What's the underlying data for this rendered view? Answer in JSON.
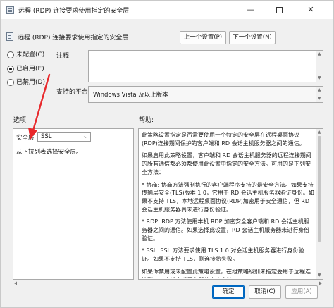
{
  "window": {
    "title": "远程 (RDP) 连接要求使用指定的安全层",
    "controls": {
      "minimize": "—",
      "close": "✕"
    }
  },
  "header": {
    "policy_name": "远程 (RDP) 连接要求使用指定的安全层",
    "prev_button": "上一个设置(P)",
    "next_button": "下一个设置(N)"
  },
  "state": {
    "options": [
      {
        "label": "未配置(C)",
        "selected": false
      },
      {
        "label": "已启用(E)",
        "selected": true
      },
      {
        "label": "已禁用(D)",
        "selected": false
      }
    ]
  },
  "comment": {
    "label": "注释:",
    "value": ""
  },
  "supported_on": {
    "label": "支持的平台:",
    "value": "Windows Vista 及以上版本"
  },
  "options_panel": {
    "label": "选项:",
    "field_label": "安全层",
    "selected_value": "SSL",
    "description": "从下拉列表选择安全层。"
  },
  "help_panel": {
    "label": "帮助:",
    "paragraphs": [
      "此策略设置指定是否需要使用一个特定的安全层在远程桌面协议(RDP)连接期间保护的客户端和 RD 会话主机服务器之间的通信。",
      "如果启用此策略设置，客户端和 RD 会话主机服务器的远程连接期间的所有通信都必须都使用此设置中指定的安全方法。可用的是下列安全方法：",
      "* 协商: 协商方法强制执行的客户端程序支持的最安全方法。如果支持传输层安全(TLS)版本 1.0，它用于 RD 会话主机服务器验证身份。如果不支持 TLS，本地远程桌面协议(RDP)加密用于安全通信，但 RD 会话主机服务器尚未进行身份验证。",
      "* RDP: RDP 方法使用本机 RDP 加密安全客户端和 RD 会话主机服务器之间的通信。如果选择此设置，RD 会话主机服务器未进行身份验证。",
      "* SSL: SSL 方法要求使用 TLS 1.0 对会话主机服务器进行身份验证。如果不支持 TLS，则连接将失败。",
      "如果你禁用或未配置此策略设置，在组策略级别未指定要用于远程连接到 RD 会话主机服务器的安全方法。"
    ]
  },
  "footer": {
    "ok": "确定",
    "cancel": "取消(C)",
    "apply": "应用(A)"
  },
  "colors": {
    "annotation_arrow": "#e8282b",
    "accent": "#0067c0"
  }
}
